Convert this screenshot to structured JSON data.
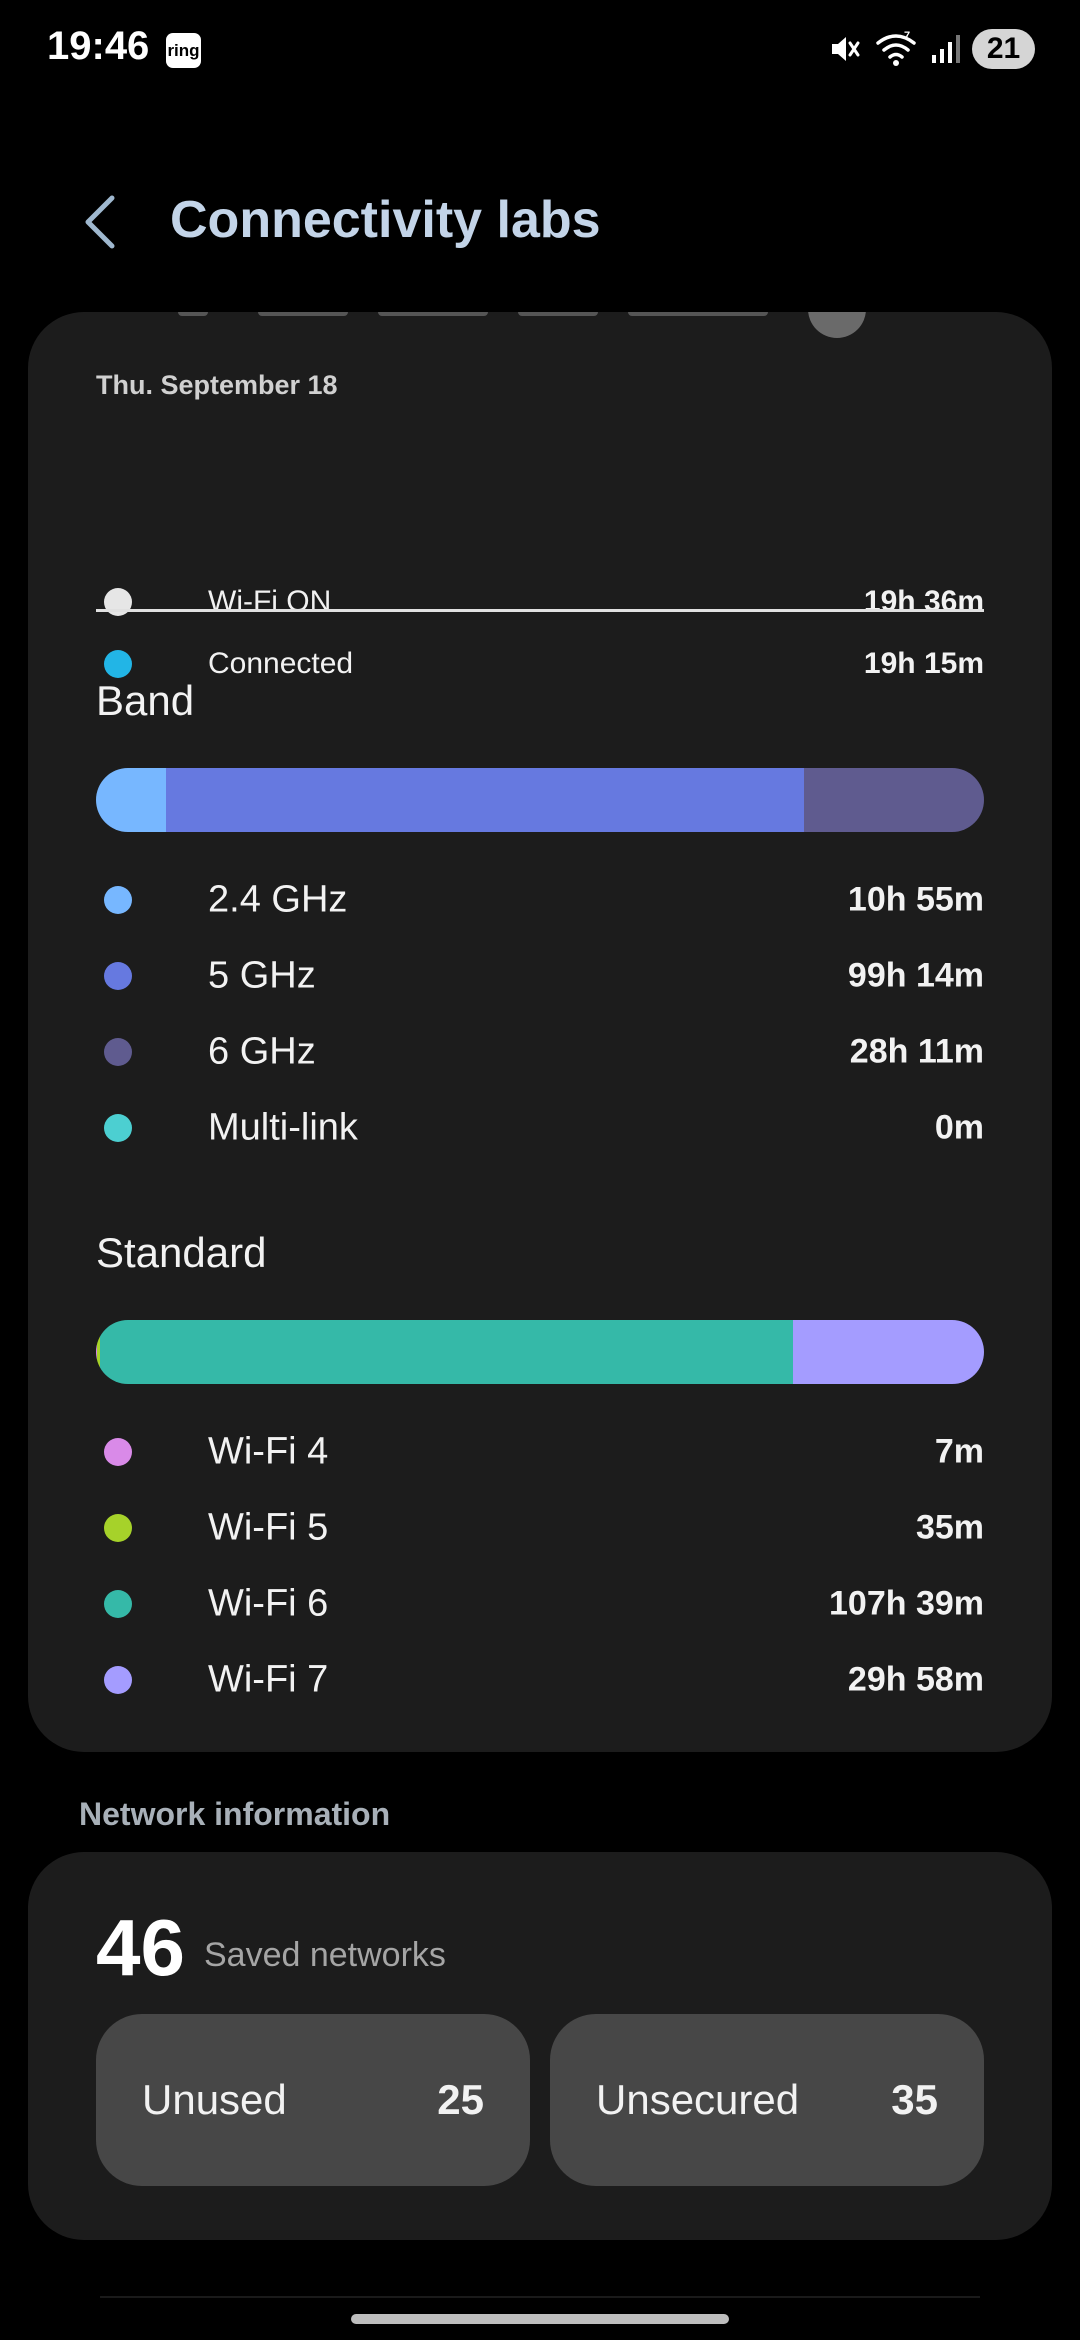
{
  "status_bar": {
    "time": "19:46",
    "notification_app": "ring",
    "battery_level": "21",
    "icons": [
      "mute-icon",
      "wifi-7-icon",
      "signal-icon"
    ]
  },
  "header": {
    "title": "Connectivity labs",
    "back_icon": "chevron-left-icon"
  },
  "usage": {
    "date": "Thu. September 18",
    "summary": [
      {
        "label": "Wi-Fi ON",
        "value": "19h 36m",
        "color": "#e6e6e6"
      },
      {
        "label": "Connected",
        "value": "19h 15m",
        "color": "#22b5e6"
      }
    ],
    "band": {
      "title": "Band",
      "bar_fractions": [
        0.079,
        0.718,
        0.203,
        0.0
      ],
      "items": [
        {
          "label": "2.4 GHz",
          "value": "10h 55m",
          "color": "#77b7ff"
        },
        {
          "label": "5 GHz",
          "value": "99h 14m",
          "color": "#6679e0"
        },
        {
          "label": "6 GHz",
          "value": "28h 11m",
          "color": "#5f5b8f"
        },
        {
          "label": "Multi-link",
          "value": "0m",
          "color": "#4ccfd1"
        }
      ]
    },
    "standard": {
      "title": "Standard",
      "bar_fractions": [
        0.001,
        0.004,
        0.78,
        0.215
      ],
      "items": [
        {
          "label": "Wi-Fi 4",
          "value": "7m",
          "color": "#d98ae8"
        },
        {
          "label": "Wi-Fi 5",
          "value": "35m",
          "color": "#a6d22a"
        },
        {
          "label": "Wi-Fi 6",
          "value": "107h 39m",
          "color": "#35b9a8"
        },
        {
          "label": "Wi-Fi 7",
          "value": "29h 58m",
          "color": "#a49cff"
        }
      ]
    }
  },
  "network_info": {
    "heading": "Network information",
    "saved_count": "46",
    "saved_label": "Saved networks",
    "unused_label": "Unused",
    "unused_value": "25",
    "unsecured_label": "Unsecured",
    "unsecured_value": "35"
  }
}
